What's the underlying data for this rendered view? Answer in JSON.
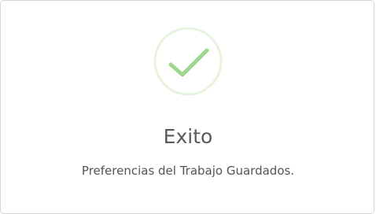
{
  "dialog": {
    "icon": "check-icon",
    "title": "Exito",
    "message": "Preferencias del Trabajo Guardados."
  },
  "colors": {
    "success_check": "#9ed88e",
    "success_ring": "#e6f3df",
    "title": "#595959",
    "message": "#545454"
  }
}
